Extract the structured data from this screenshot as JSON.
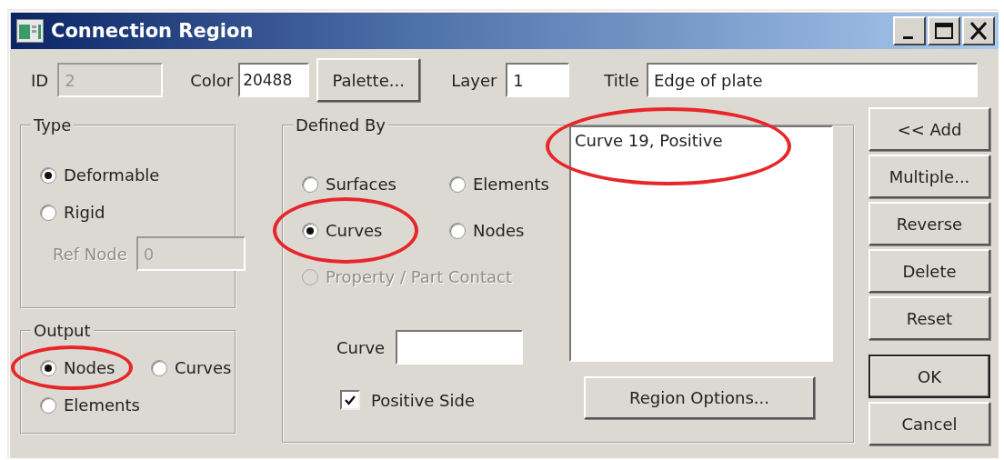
{
  "window": {
    "title": "Connection Region"
  },
  "title_bar_buttons": [
    {
      "kind": "minimize"
    },
    {
      "kind": "maximize"
    },
    {
      "kind": "close"
    }
  ],
  "header": {
    "id": {
      "label": "ID",
      "value": "2",
      "disabled": true
    },
    "color": {
      "label": "Color",
      "value": "20488"
    },
    "palette_button": "Palette...",
    "layer": {
      "label": "Layer",
      "value": "1"
    },
    "title": {
      "label": "Title",
      "value": "Edge of plate"
    }
  },
  "type_group": {
    "label": "Type",
    "options": [
      {
        "label": "Deformable",
        "selected": true
      },
      {
        "label": "Rigid",
        "selected": false
      }
    ],
    "ref_node": {
      "label": "Ref Node",
      "value": "0",
      "disabled": true
    }
  },
  "output_group": {
    "label": "Output",
    "options": [
      {
        "label": "Nodes",
        "selected": true,
        "highlighted": true
      },
      {
        "label": "Curves",
        "selected": false,
        "highlighted": false
      },
      {
        "label": "Elements",
        "selected": false,
        "highlighted": false
      }
    ]
  },
  "defined_by": {
    "label": "Defined By",
    "options": [
      {
        "label": "Surfaces",
        "selected": false,
        "disabled": false,
        "highlighted": false
      },
      {
        "label": "Elements",
        "selected": false,
        "disabled": false,
        "highlighted": false
      },
      {
        "label": "Curves",
        "selected": true,
        "disabled": false,
        "highlighted": true
      },
      {
        "label": "Nodes",
        "selected": false,
        "disabled": false,
        "highlighted": false
      },
      {
        "label": "Property / Part Contact",
        "selected": false,
        "disabled": true,
        "highlighted": false
      }
    ],
    "curve_field": {
      "label": "Curve"
    },
    "positive_side": {
      "label": "Positive Side",
      "checked": true
    },
    "list": [
      {
        "text": "Curve 19, Positive",
        "highlighted": true
      }
    ],
    "region_options_button": "Region Options..."
  },
  "buttons": [
    {
      "label": "<< Add",
      "default": false
    },
    {
      "label": "Multiple...",
      "default": false
    },
    {
      "label": "Reverse",
      "default": false
    },
    {
      "label": "Delete",
      "default": false
    },
    {
      "label": "Reset",
      "default": false
    },
    {
      "label": "OK",
      "default": true
    },
    {
      "label": "Cancel",
      "default": false
    }
  ]
}
